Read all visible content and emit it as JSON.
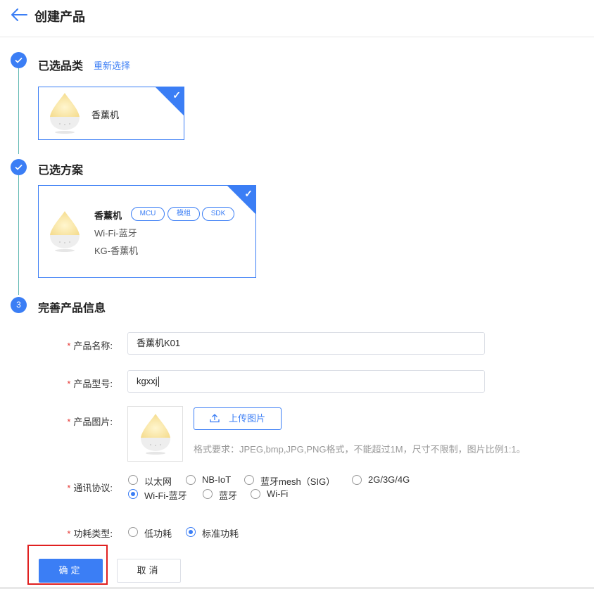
{
  "header": {
    "title": "创建产品",
    "back_icon": "arrow-left-icon"
  },
  "steps": {
    "category": {
      "title": "已选品类",
      "reselect_label": "重新选择",
      "card": {
        "name": "香薰机",
        "icon": "aroma-diffuser-image"
      }
    },
    "scheme": {
      "title": "已选方案",
      "card": {
        "name": "香薰机",
        "tags": [
          "MCU",
          "模组",
          "SDK"
        ],
        "line1": "Wi-Fi-蓝牙",
        "line2": "KG-香薰机"
      }
    },
    "info": {
      "number": "3",
      "title": "完善产品信息"
    }
  },
  "form": {
    "required_mark": "*",
    "name_label": "产品名称:",
    "name_value": "香薰机K01",
    "model_label": "产品型号:",
    "model_value": "kgxxj",
    "image_label": "产品图片:",
    "upload_label": "上传图片",
    "upload_hint": "格式要求：JPEG,bmp,JPG,PNG格式，不能超过1M，尺寸不限制，图片比例1:1。",
    "protocol_label": "通讯协议:",
    "protocols": [
      {
        "label": "以太网",
        "selected": false
      },
      {
        "label": "NB-IoT",
        "selected": false
      },
      {
        "label": "蓝牙mesh（SIG）",
        "selected": false
      },
      {
        "label": "2G/3G/4G",
        "selected": false
      },
      {
        "label": "Wi-Fi-蓝牙",
        "selected": true
      },
      {
        "label": "蓝牙",
        "selected": false
      },
      {
        "label": "Wi-Fi",
        "selected": false
      }
    ],
    "power_label": "功耗类型:",
    "power_options": [
      {
        "label": "低功耗",
        "selected": false
      },
      {
        "label": "标准功耗",
        "selected": true
      }
    ]
  },
  "actions": {
    "confirm_label": "确定",
    "cancel_label": "取消"
  },
  "colors": {
    "accent": "#3b7ef5",
    "required": "#e53935",
    "highlight": "#e02020",
    "step_line": "#5fb6b1"
  }
}
